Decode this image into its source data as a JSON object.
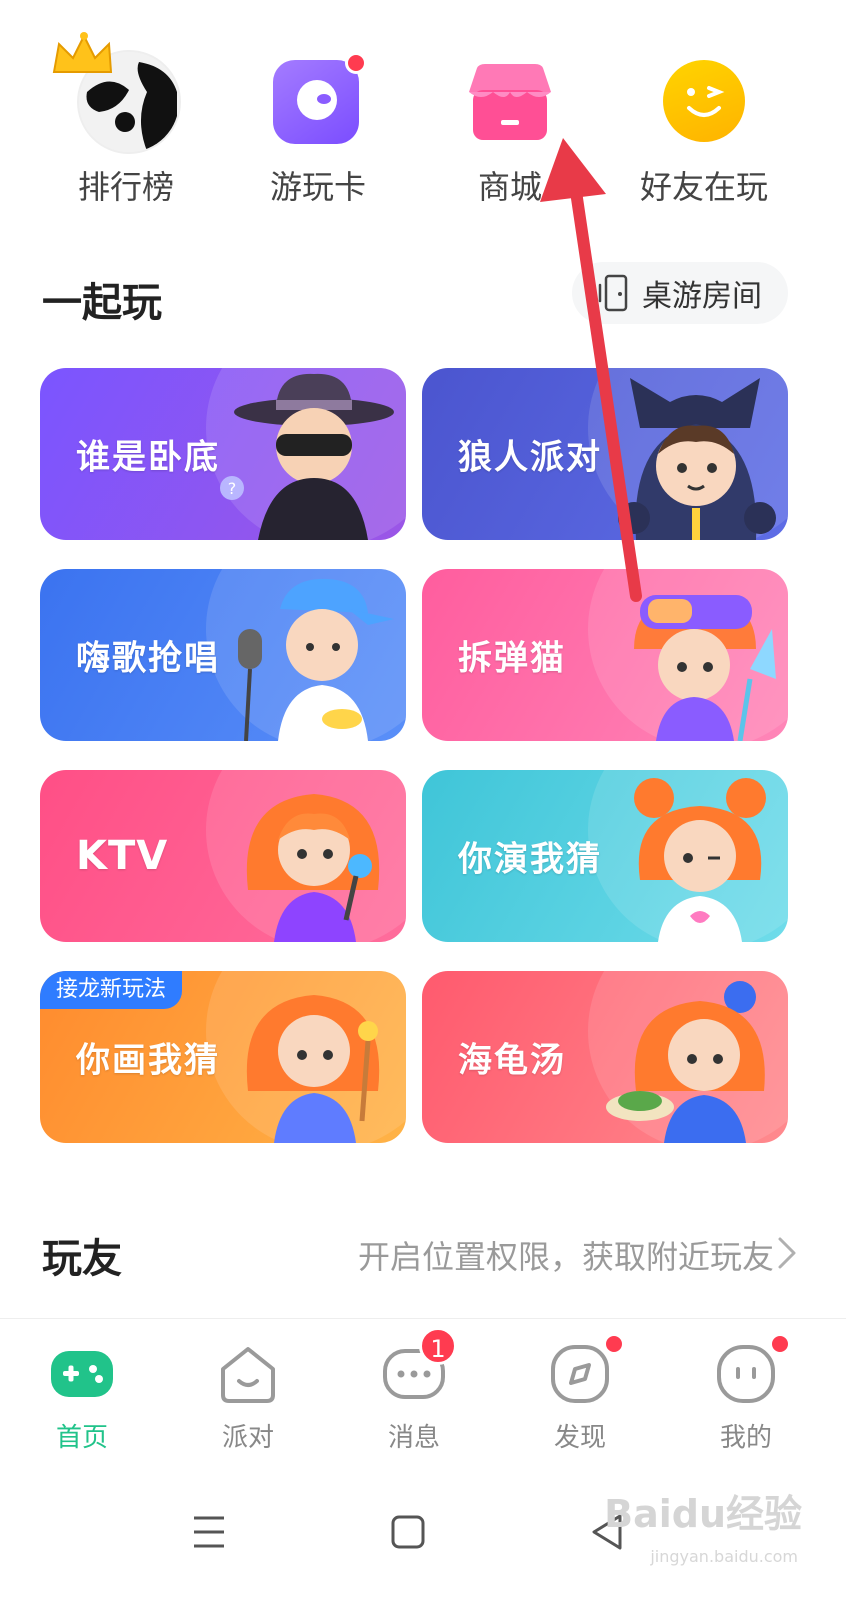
{
  "top_entries": [
    {
      "label": "排行榜",
      "icon": "ranking-avatar-icon"
    },
    {
      "label": "游玩卡",
      "icon": "play-card-icon"
    },
    {
      "label": "商城",
      "icon": "shop-icon"
    },
    {
      "label": "好友在玩",
      "icon": "friends-playing-icon"
    }
  ],
  "section": {
    "title": "一起玩",
    "room_button": "桌游房间"
  },
  "games": [
    {
      "label": "谁是卧底",
      "color": "#7a57f0"
    },
    {
      "label": "狼人派对",
      "color": "#4f5dd6"
    },
    {
      "label": "嗨歌抢唱",
      "color": "#3b7df5"
    },
    {
      "label": "拆弹猫",
      "color": "#ff6fa8"
    },
    {
      "label": "KTV",
      "color": "#ff5b8a"
    },
    {
      "label": "你演我猜",
      "color": "#4fd0e0"
    },
    {
      "label": "你画我猜",
      "color": "#ffa43a",
      "tag": "接龙新玩法"
    },
    {
      "label": "海龟汤",
      "color": "#ff6b7d"
    }
  ],
  "friends": {
    "title": "玩友",
    "hint": "开启位置权限，获取附近玩友"
  },
  "nav": [
    {
      "label": "首页",
      "icon": "gamepad-icon",
      "active": true
    },
    {
      "label": "派对",
      "icon": "party-house-icon"
    },
    {
      "label": "消息",
      "icon": "message-icon",
      "badge": "1"
    },
    {
      "label": "发现",
      "icon": "compass-icon",
      "dot": true
    },
    {
      "label": "我的",
      "icon": "profile-face-icon",
      "dot": true
    }
  ],
  "accent": "#21c38a",
  "watermark": {
    "main": "Baidu经验",
    "sub": "jingyan.baidu.com"
  }
}
